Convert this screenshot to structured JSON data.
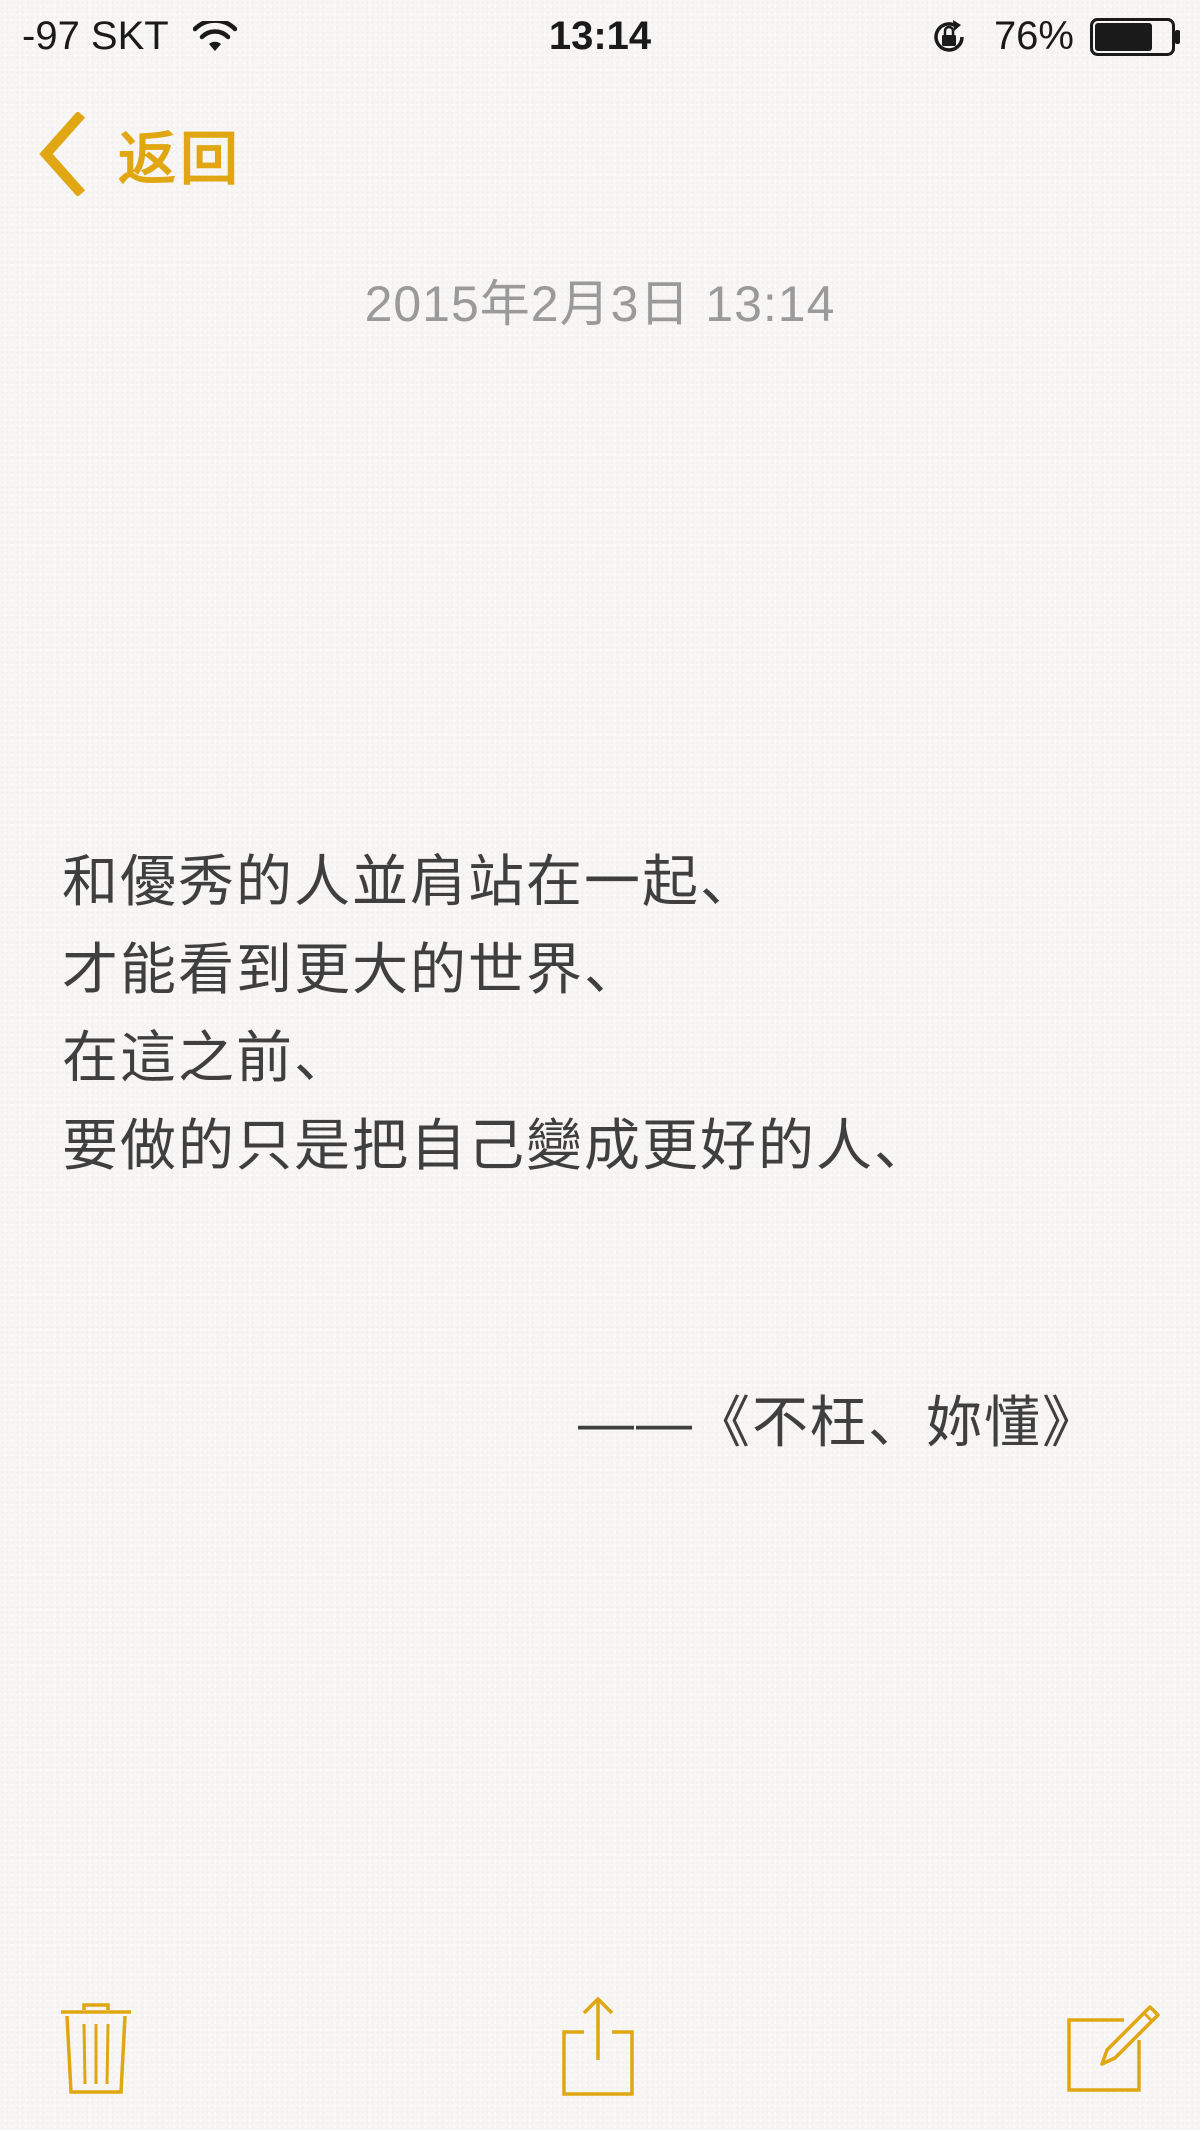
{
  "status_bar": {
    "carrier": "-97 SKT",
    "time": "13:14",
    "battery": "76%",
    "battery_level": 0.76,
    "icons": [
      "wifi-icon",
      "orientation-lock-icon",
      "battery-icon"
    ]
  },
  "nav": {
    "back_label": "返回",
    "back_icon": "chevron-left-icon"
  },
  "note": {
    "date": "2015年2月3日 13:14",
    "lines": [
      "和優秀的人並肩站在一起、",
      "才能看到更大的世界、",
      "在這之前、",
      "要做的只是把自己變成更好的人、"
    ],
    "signature": "——《不枉、妳懂》"
  },
  "toolbar": {
    "icons": [
      "trash-icon",
      "share-icon",
      "compose-icon"
    ]
  },
  "colors": {
    "accent": "#e0a712",
    "text": "#3f3f3f",
    "date": "#9a9a9a",
    "background": "#f7f6f4"
  }
}
